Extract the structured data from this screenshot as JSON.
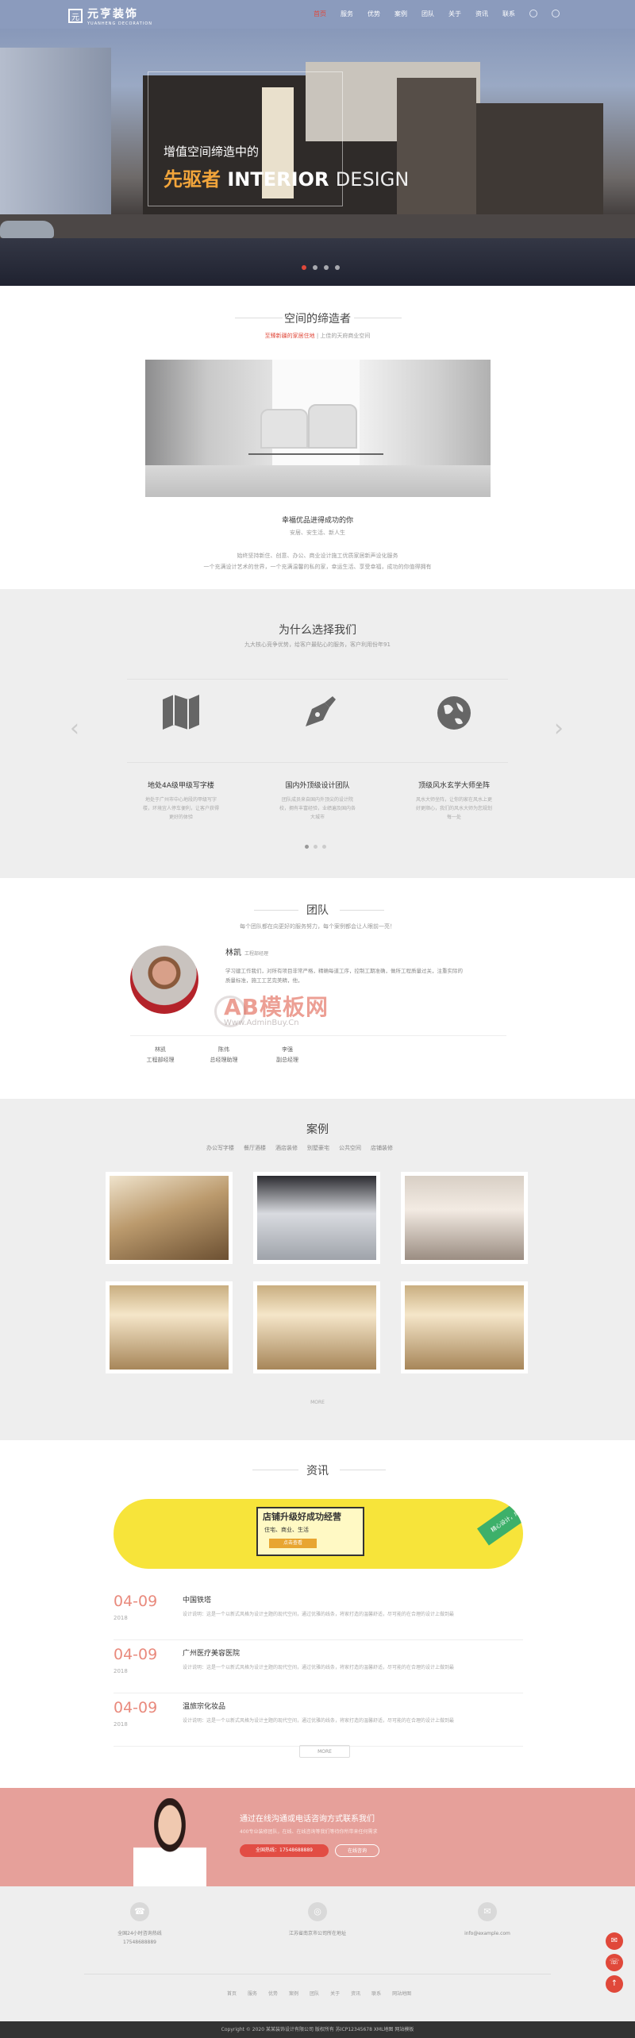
{
  "header": {
    "logo_main": "元亨装饰",
    "logo_sub": "YUANHENG DECORATION",
    "nav": [
      "首页",
      "服务",
      "优势",
      "案例",
      "团队",
      "关于",
      "资讯",
      "联系"
    ]
  },
  "hero": {
    "line1": "增值空间缔造中的",
    "line2_cn": "先驱者",
    "line2_en_bold": "INTERIOR",
    "line2_en_light": "DESIGN"
  },
  "about": {
    "title": "空间的缔造者",
    "sub_red": "至臻新疆的家居住地",
    "sub_gray": "上佳的天府商业空间",
    "caption": "幸福优品进得成功的你",
    "caption_sub": "安居、安生活、新人生",
    "para1": "始终坚持新住、创意、办公、商业设计施工优质家居新声设化服务",
    "para2": "一个充满设计艺术的世界，一个充满温馨的私的家，幸运生活、享受幸福，成功的你值得拥有"
  },
  "why": {
    "title": "为什么选择我们",
    "sub": "九大核心竞争优势，给客户最贴心的服务，客户利用份年91",
    "items": [
      {
        "icon": "map-icon",
        "title": "地处4A级甲级写字楼",
        "desc": "地处于广州市中心地段的甲级写字楼，环境宜人停车便利，让客户获得更好的体验"
      },
      {
        "icon": "pen-icon",
        "title": "国内外顶级设计团队",
        "desc": "团队成员来自国内外顶尖的设计院校，拥有丰富经验，业绩遍及国内各大城市"
      },
      {
        "icon": "globe-icon",
        "title": "顶级风水玄学大师坐阵",
        "desc": "风水大师坐阵，让你的家在风水上更好更顺心，我们的风水大师为您规划每一处"
      }
    ]
  },
  "team": {
    "title": "团队",
    "sub": "每个团队都在向更好的服务努力，每个案例都会让人眼前一亮！",
    "featured_name": "林凯",
    "featured_role": "工程部经理",
    "featured_desc": "学习建工作我们，对所有项目非常严格，精确每道工序，控制工期准确，做所工程质量过关，注重实际的质量标准，施工工艺完美精，他，",
    "members": [
      {
        "name": "林凯",
        "role": "工程部经理"
      },
      {
        "name": "陈伟",
        "role": "总经理助理"
      },
      {
        "name": "李强",
        "role": "副总经理"
      }
    ],
    "watermark": "AB模板网",
    "watermark_url": "Www.AdminBuy.Cn"
  },
  "cases": {
    "title": "案例",
    "tabs": [
      "办公写字楼",
      "餐厅酒楼",
      "酒店装修",
      "别墅豪宅",
      "公共空间",
      "店铺装修"
    ],
    "more": "MORE"
  },
  "news": {
    "title": "资讯",
    "banner_title": "店铺升级好成功经营",
    "banner_tag": "住宅、商业、生活",
    "banner_tag2": "点击查看",
    "banner_corner": "精心设计，成就经典",
    "items": [
      {
        "date": "04-09",
        "year": "2018",
        "title": "中国铁塔",
        "desc": "设计说明：这是一个以新式风格为设计主题的现代空间，通过优雅的线条，将家打造的温馨舒适，尽可能的在合理的设计上做到最"
      },
      {
        "date": "04-09",
        "year": "2018",
        "title": "广州医疗美容医院",
        "desc": "设计说明：这是一个以新式风格为设计主题的现代空间，通过优雅的线条，将家打造的温馨舒适，尽可能的在合理的设计上做到最"
      },
      {
        "date": "04-09",
        "year": "2018",
        "title": "温旅宗化妆品",
        "desc": "设计说明：这是一个以新式风格为设计主题的现代空间，通过优雅的线条，将家打造的温馨舒适，尽可能的在合理的设计上做到最"
      }
    ],
    "more": "MORE"
  },
  "contact": {
    "title": "通过在线沟通或电话咨询方式联系我们",
    "sub": "400专业装修团队，在线、在线咨询等我们等待你所带来任何需求",
    "btn_phone": "全国热线：17548688889",
    "btn_online": "在线咨询"
  },
  "footer": {
    "cols": [
      {
        "icon": "phone-icon",
        "line1": "全国24小时咨询热线",
        "line2": "17548688889"
      },
      {
        "icon": "location-icon",
        "line1": "江苏省南京市公司所在地址",
        "line2": ""
      },
      {
        "icon": "mail-icon",
        "line1": "info@example.com",
        "line2": ""
      }
    ],
    "links": [
      "首页",
      "服务",
      "优势",
      "案例",
      "团队",
      "关于",
      "资讯",
      "联系",
      "网站地图"
    ],
    "copyright": "Copyright © 2020 某某装饰设计有限公司 版权所有 苏ICP12345678 XML地图 网站模板"
  }
}
